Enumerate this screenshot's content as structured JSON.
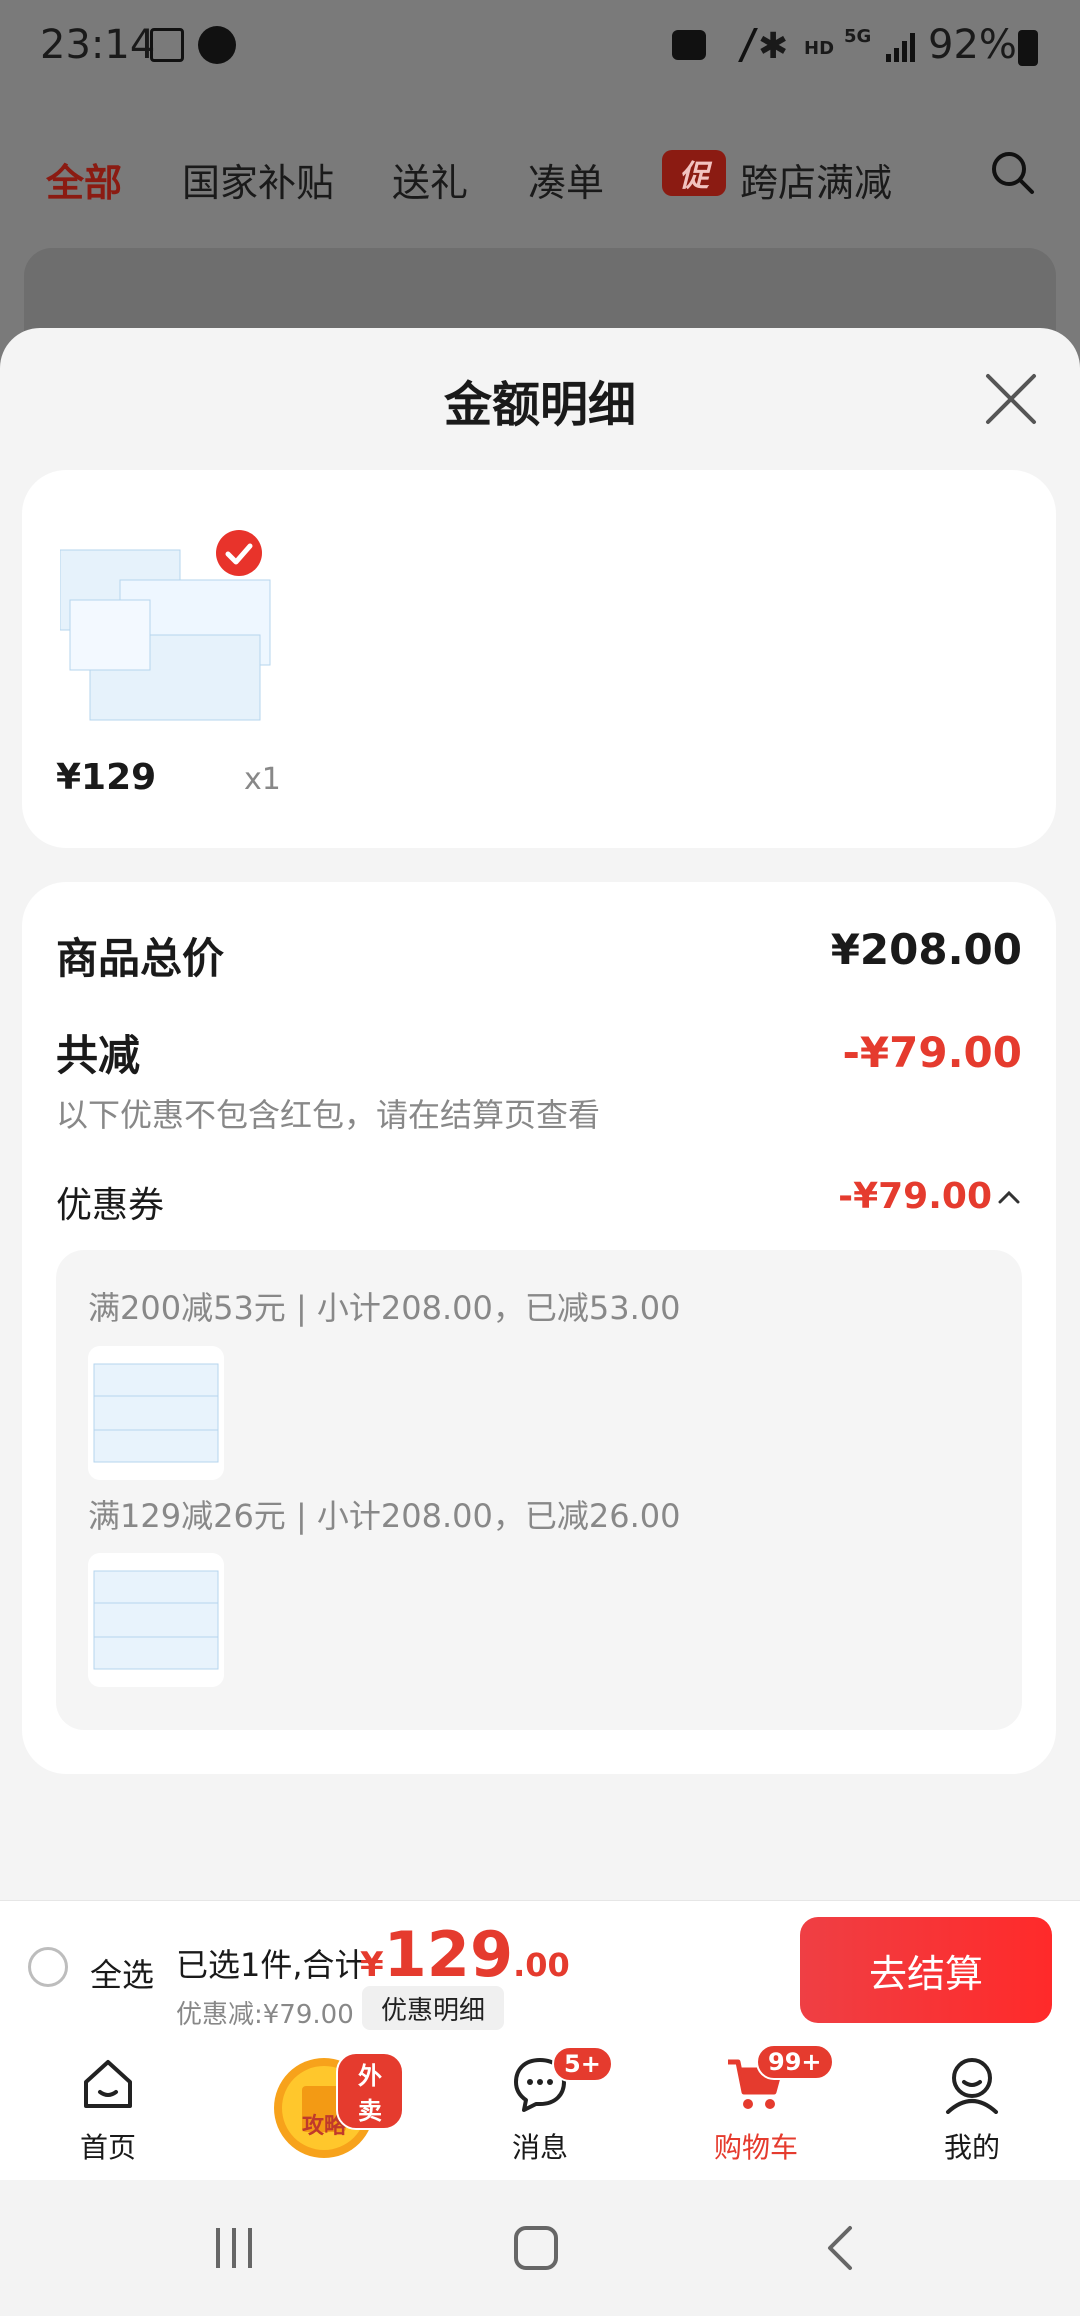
{
  "status_bar": {
    "time": "23:14",
    "battery": "92%",
    "network": "5G",
    "hd": "HD"
  },
  "background": {
    "tabs": [
      "全部",
      "国家补贴",
      "送礼",
      "凑单",
      "跨店满减"
    ],
    "promo_badge": "促"
  },
  "sheet": {
    "title": "金额明细",
    "product": {
      "price": "¥129",
      "qty": "x1"
    },
    "total_label": "商品总价",
    "total_value": "¥208.00",
    "reduce_label": "共减",
    "reduce_value": "-¥79.00",
    "reduce_note": "以下优惠不包含红包，请在结算页查看",
    "coupon_label": "优惠券",
    "coupon_value": "-¥79.00",
    "coupons": [
      {
        "text": "满200减53元 | 小计208.00，已减53.00"
      },
      {
        "text": "满129减26元 | 小计208.00，已减26.00"
      }
    ]
  },
  "action_bar": {
    "select_all": "全选",
    "selected_prefix": "已选1件,合计:",
    "total_symbol": "¥",
    "total_int": "129",
    "total_dec": ".00",
    "discount": "优惠减:¥79.00",
    "detail_button": "优惠明细",
    "checkout": "去结算"
  },
  "tab_bar": {
    "items": [
      {
        "label": "首页"
      },
      {
        "label": "攻略",
        "badge": "外卖"
      },
      {
        "label": "消息",
        "badge": "5+"
      },
      {
        "label": "购物车",
        "badge": "99+"
      },
      {
        "label": "我的"
      }
    ]
  },
  "colors": {
    "accent": "#e53b2e",
    "checkout": "#ff2a2a"
  }
}
